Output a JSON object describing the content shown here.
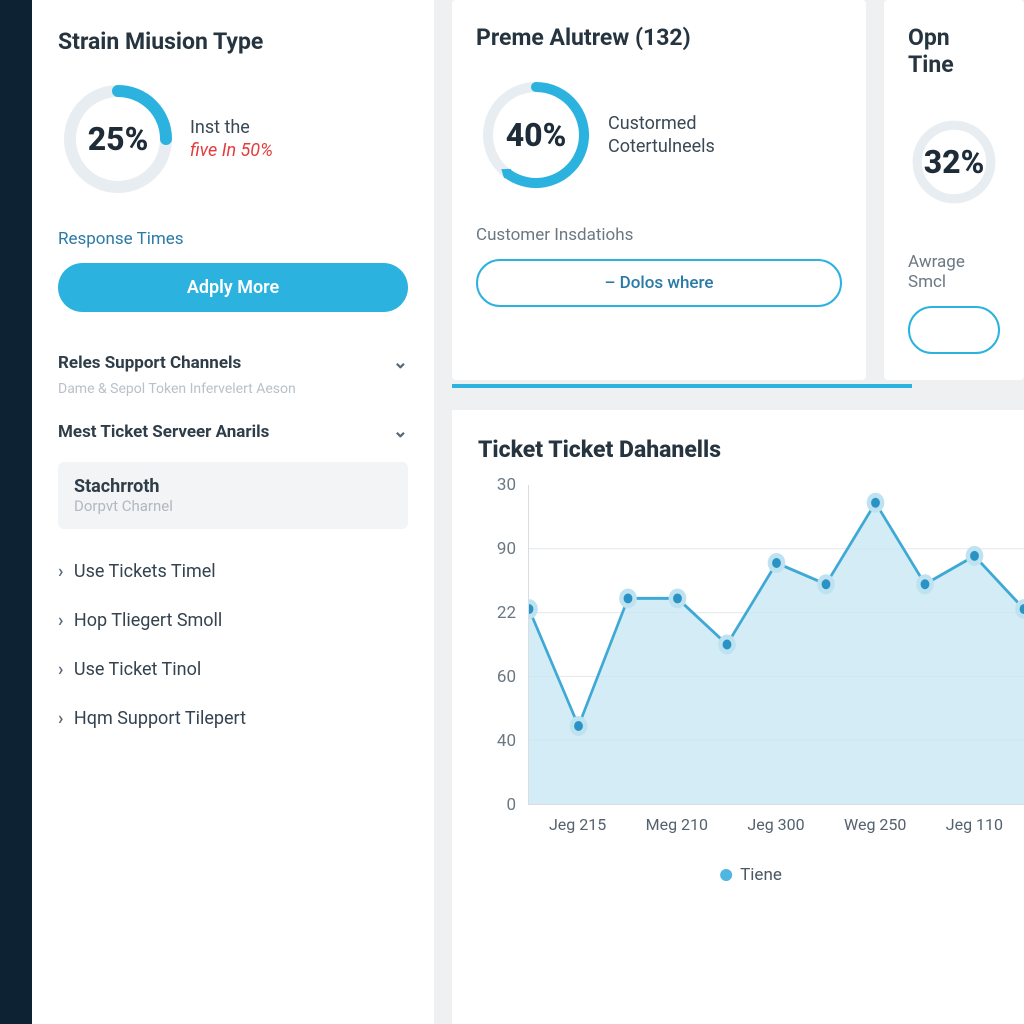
{
  "colors": {
    "accent": "#2bb2df",
    "danger": "#e33c3c",
    "nav": "#0d2233"
  },
  "card1": {
    "title": "Strain Miusion Type",
    "pct": "25%",
    "arc_fraction": 0.25,
    "label_line1": "Inst the",
    "label_line2": "five In 50%",
    "sub": "Response Times",
    "button": "Adply More"
  },
  "card2": {
    "title": "Preme Alutrew (132)",
    "pct": "40%",
    "arc_fraction": 0.6,
    "label_line1": "Custormed",
    "label_line2": "Cotertulneels",
    "sub": "Customer Insdatiohs",
    "button": "– Dolos where"
  },
  "card3": {
    "title": "Opn Tine",
    "pct": "32%",
    "sub": "Awrage Smcl"
  },
  "accordion1": {
    "title": "Reles Support Channels",
    "sub": "Dame & Sepol Token Infervelert Aeson"
  },
  "accordion2": {
    "title": "Mest Ticket Serveer Anarils"
  },
  "selected": {
    "title": "Stachrroth",
    "sub": "Dorpvt Charnel"
  },
  "list": [
    "Use Tickets Timel",
    "Hop Tliegert Smoll",
    "Use Ticket Tinol",
    "Hqm Support Tilepert"
  ],
  "chart_title": "Ticket Ticket Dahanells",
  "chart_data": {
    "type": "line",
    "title": "Ticket Ticket Dahanells",
    "xlabel": "",
    "ylabel": "",
    "ylim": [
      0,
      90
    ],
    "y_ticks": [
      "30",
      "90",
      "22",
      "60",
      "40",
      "0"
    ],
    "categories": [
      "Jeg 215",
      "Meg 210",
      "Jeg 300",
      "Weg 250",
      "Jeg 110"
    ],
    "series": [
      {
        "name": "Tiene",
        "values": [
          55,
          22,
          58,
          58,
          45,
          68,
          62,
          85,
          62,
          70,
          55
        ]
      }
    ],
    "legend": "Tiene"
  }
}
